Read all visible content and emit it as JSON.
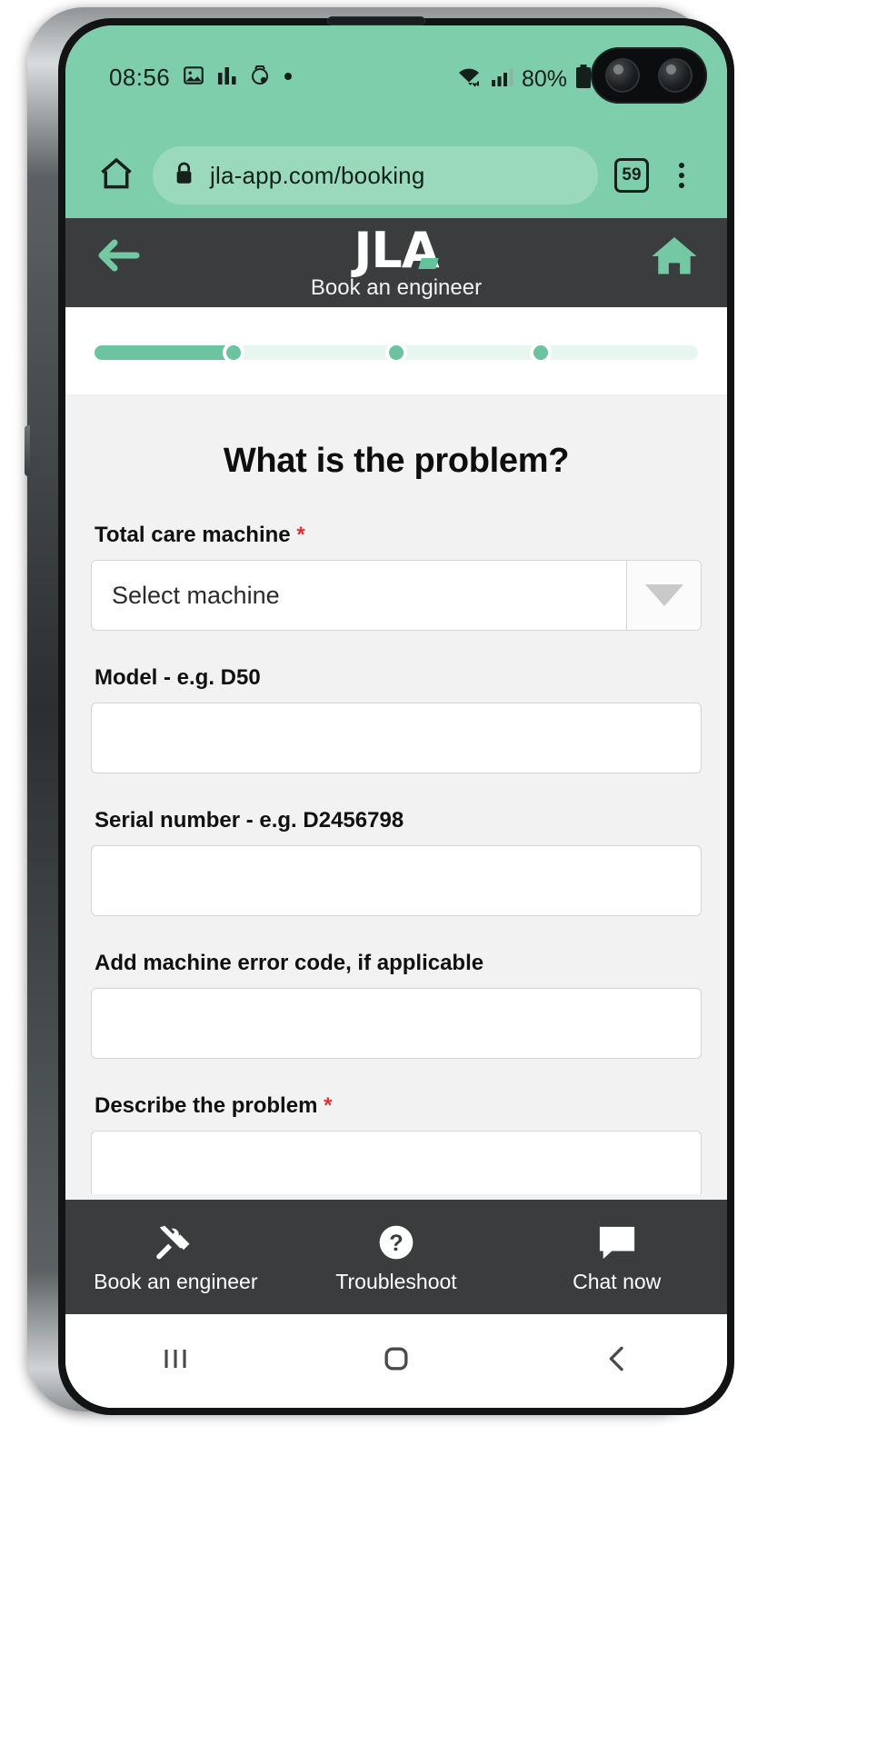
{
  "device": {
    "frame": "samsung-galaxy-phone"
  },
  "statusbar": {
    "time": "08:56",
    "battery_percent": "80%",
    "icons": [
      "image-icon",
      "bar-chart-icon",
      "watch-icon",
      "dot-icon",
      "wifi-icon",
      "cellular-signal-icon",
      "battery-icon"
    ]
  },
  "browser": {
    "home_icon": "home-icon",
    "lock_icon": "lock-icon",
    "url": "jla-app.com/booking",
    "tab_count": "59",
    "menu_icon": "overflow-menu-icon"
  },
  "app_header": {
    "back_icon": "back-arrow-icon",
    "logo": "JLA",
    "subtitle": "Book an engineer",
    "home_icon": "home-icon"
  },
  "progress": {
    "total_steps": 4,
    "current_step": 1,
    "fill_percent": 23,
    "dot_positions_percent": [
      23,
      50,
      74
    ],
    "colors": {
      "fill": "#6bc3a0",
      "track": "#e7f6ef"
    }
  },
  "form": {
    "title": "What is the problem?",
    "fields": [
      {
        "label": "Total care machine",
        "required": true,
        "type": "select",
        "value": "Select machine",
        "options": [
          "Select machine"
        ]
      },
      {
        "label": "Model - e.g. D50",
        "required": false,
        "type": "text",
        "value": ""
      },
      {
        "label": "Serial number - e.g. D2456798",
        "required": false,
        "type": "text",
        "value": ""
      },
      {
        "label": "Add machine error code, if applicable",
        "required": false,
        "type": "text",
        "value": ""
      },
      {
        "label": "Describe the problem",
        "required": true,
        "type": "textarea",
        "value": ""
      }
    ],
    "required_marker": "*"
  },
  "bottom_nav": {
    "items": [
      {
        "label": "Book an engineer",
        "icon": "tools-icon"
      },
      {
        "label": "Troubleshoot",
        "icon": "question-mark-icon"
      },
      {
        "label": "Chat now",
        "icon": "chat-bubble-icon"
      }
    ]
  },
  "android_nav": {
    "recents_icon": "recents-icon",
    "home_icon": "home-circle-icon",
    "back_icon": "back-chevron-icon"
  },
  "colors": {
    "browser_green": "#7ecdab",
    "accent_green": "#6bc3a0",
    "header_dark": "#3a3c3e",
    "page_bg": "#f2f2f2",
    "required_red": "#e53030"
  }
}
